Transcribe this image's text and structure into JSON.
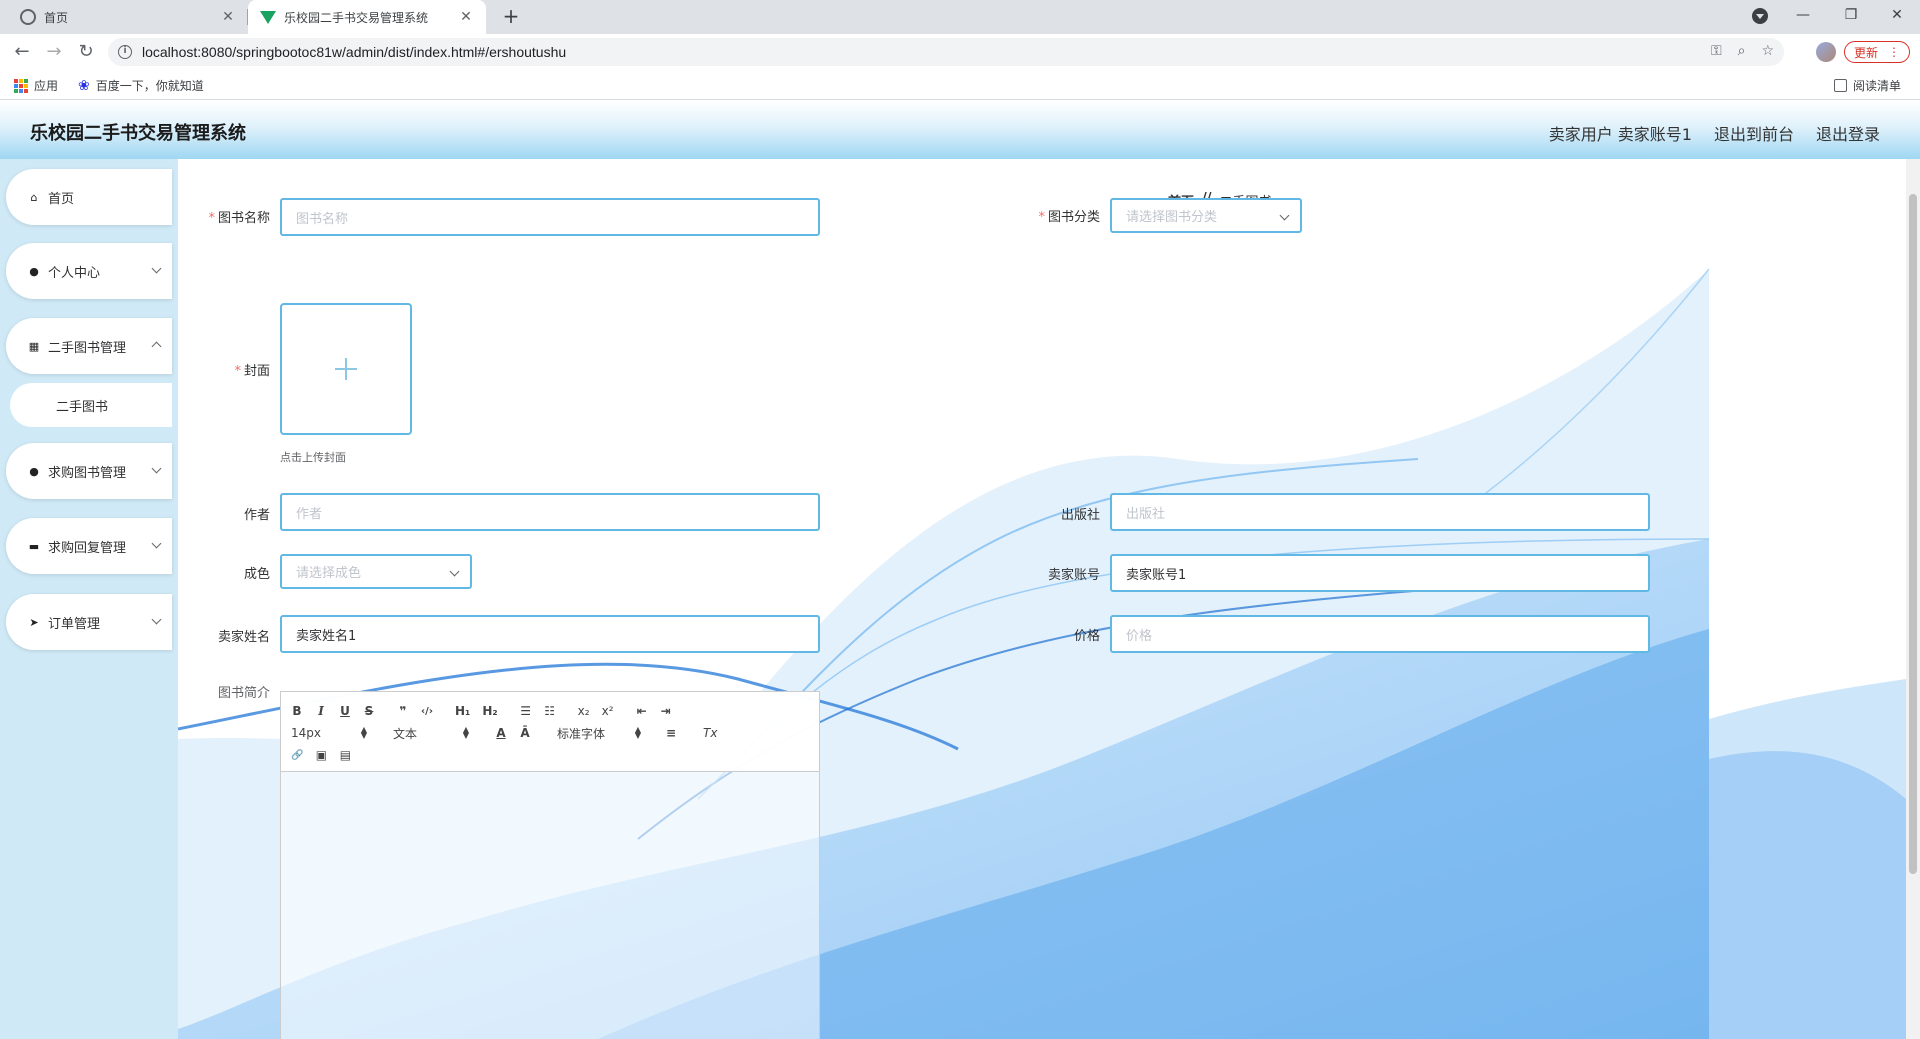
{
  "browser": {
    "tabs": [
      {
        "title": "首页",
        "active": false
      },
      {
        "title": "乐校园二手书交易管理系统",
        "active": true
      }
    ],
    "url": "localhost:8080/springbootoc81w/admin/dist/index.html#/ershoutushu",
    "bookmarks": {
      "apps": "应用",
      "baidu": "百度一下，你就知道",
      "reading_list": "阅读清单"
    },
    "update_label": "更新"
  },
  "header": {
    "title": "乐校园二手书交易管理系统",
    "user": "卖家用户 卖家账号1",
    "to_front": "退出到前台",
    "logout": "退出登录"
  },
  "sidebar": {
    "items": [
      {
        "label": "首页",
        "icon": "home-icon"
      },
      {
        "label": "个人中心",
        "icon": "user-icon"
      },
      {
        "label": "二手图书管理",
        "icon": "grid-icon"
      },
      {
        "label": "求购图书管理",
        "icon": "pin-icon"
      },
      {
        "label": "求购回复管理",
        "icon": "monitor-icon"
      },
      {
        "label": "订单管理",
        "icon": "send-icon"
      }
    ],
    "sub_item": "二手图书"
  },
  "breadcrumb": {
    "home": "首页",
    "separator": "//",
    "current": "二手图书"
  },
  "form": {
    "book_name": {
      "label": "图书名称",
      "placeholder": "图书名称",
      "value": ""
    },
    "category": {
      "label": "图书分类",
      "placeholder": "请选择图书分类"
    },
    "cover": {
      "label": "封面",
      "tip": "点击上传封面"
    },
    "author": {
      "label": "作者",
      "placeholder": "作者"
    },
    "publisher": {
      "label": "出版社",
      "placeholder": "出版社"
    },
    "condition": {
      "label": "成色",
      "placeholder": "请选择成色"
    },
    "seller_account": {
      "label": "卖家账号",
      "value": "卖家账号1"
    },
    "seller_name": {
      "label": "卖家姓名",
      "value": "卖家姓名1"
    },
    "price": {
      "label": "价格",
      "placeholder": "价格"
    },
    "intro": {
      "label": "图书简介"
    }
  },
  "editor_toolbar": {
    "bold": "B",
    "italic": "I",
    "underline": "U",
    "strike": "S",
    "quote": "❞",
    "code": "‹/›",
    "h1": "H₁",
    "h2": "H₂",
    "ol": "☰",
    "ul": "☷",
    "sub": "x₂",
    "sup": "x²",
    "outdent": "⇤",
    "indent": "⇥",
    "size": "14px",
    "header": "文本",
    "color": "A",
    "background": "Ā",
    "font": "标准字体",
    "align": "≡",
    "clean": "Tx",
    "link": "🔗",
    "image": "▣",
    "video": "▤"
  },
  "colors": {
    "accent": "#61b8e4",
    "sidebar_bg": "#cfe9f6",
    "required": "#f56c6c"
  }
}
